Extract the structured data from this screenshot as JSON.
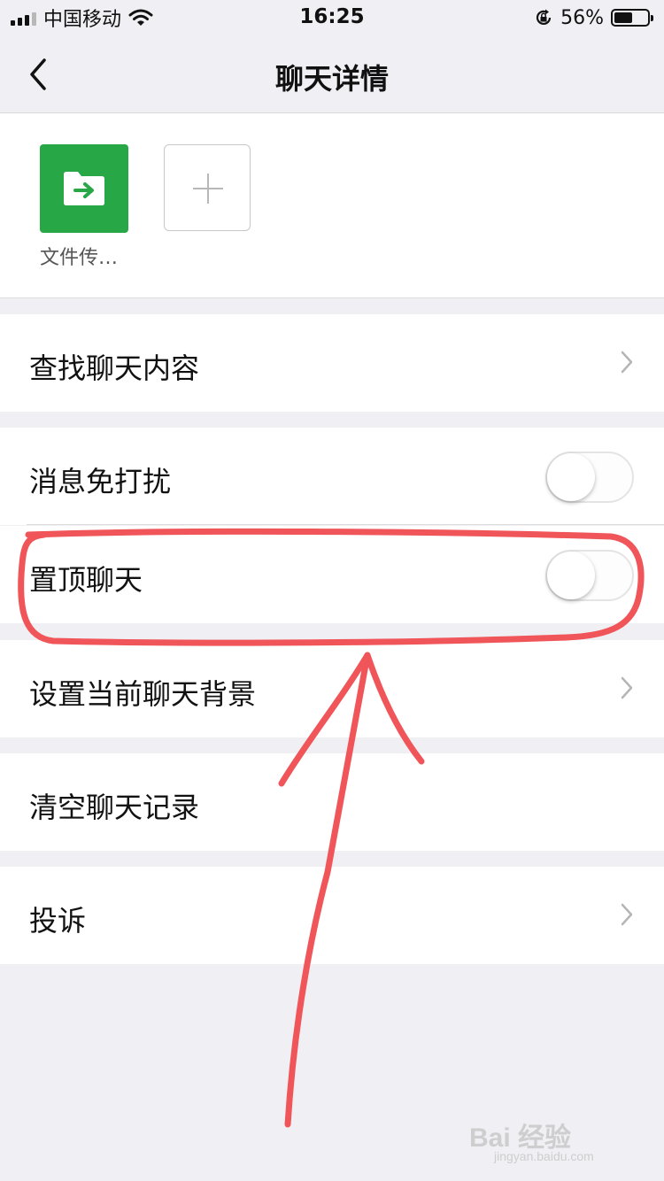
{
  "status_bar": {
    "carrier": "中国移动",
    "time": "16:25",
    "battery": "56%",
    "battery_level": 0.56
  },
  "nav": {
    "title": "聊天详情",
    "back_icon": "chevron-left-icon"
  },
  "members": [
    {
      "name": "文件传…",
      "icon": "folder-transfer-icon",
      "color": "#27a745"
    }
  ],
  "add_member_icon": "plus-icon",
  "settings": {
    "search": {
      "label": "查找聊天内容"
    },
    "mute": {
      "label": "消息免打扰",
      "on": false
    },
    "sticky": {
      "label": "置顶聊天",
      "on": false
    },
    "background": {
      "label": "设置当前聊天背景"
    },
    "clear": {
      "label": "清空聊天记录"
    },
    "report": {
      "label": "投诉"
    }
  },
  "annotation_color": "#f0555a",
  "watermark": {
    "brand": "Bai 经验",
    "url": "jingyan.baidu.com"
  }
}
